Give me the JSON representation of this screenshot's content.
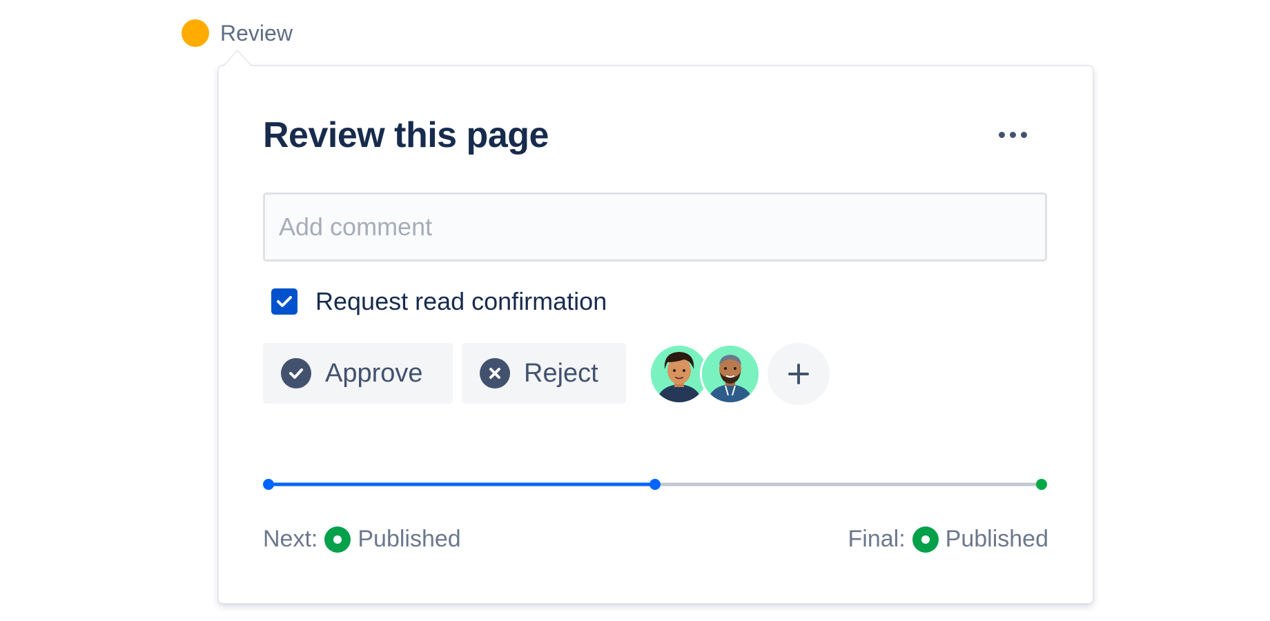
{
  "status": {
    "label": "Review",
    "color": "#FFAB00"
  },
  "panel": {
    "title": "Review this page",
    "more_icon": "ellipsis-icon",
    "comment_placeholder": "Add comment",
    "comment_value": "",
    "read_confirmation": {
      "label": "Request read confirmation",
      "checked": true
    },
    "actions": {
      "approve_label": "Approve",
      "approve_icon": "check-circle-icon",
      "reject_label": "Reject",
      "reject_icon": "cross-circle-icon"
    },
    "reviewers": [
      {
        "avatar": "avatar-woman-icon"
      },
      {
        "avatar": "avatar-man-bearded-icon"
      }
    ],
    "add_reviewer_icon": "plus-icon",
    "workflow": {
      "steps": 3,
      "current_step": 2,
      "completed_fraction": 0.5,
      "next_label": "Next:",
      "next_status": "Published",
      "final_label": "Final:",
      "final_status": "Published"
    }
  },
  "colors": {
    "accent": "#0065FF",
    "primary_text": "#172B4D",
    "status_green": "#00875A",
    "track_gray": "#C1C7D0"
  }
}
